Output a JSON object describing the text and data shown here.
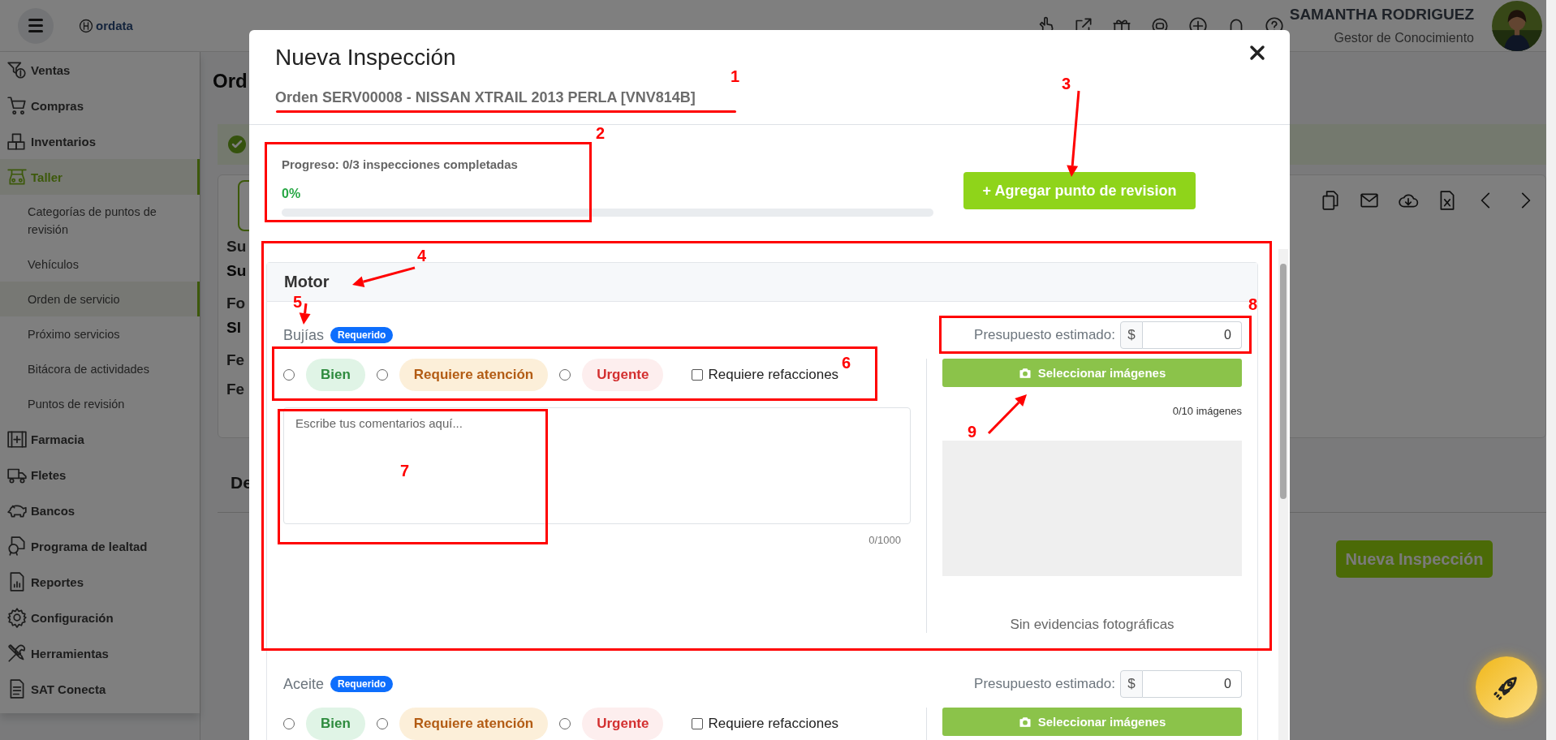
{
  "topbar": {
    "logo": "ordata",
    "user_name": "SAMANTHA RODRIGUEZ",
    "user_role": "Gestor de Conocimiento"
  },
  "sidebar": {
    "items": [
      {
        "label": "Ventas",
        "expanded": false
      },
      {
        "label": "Compras",
        "expanded": false
      },
      {
        "label": "Inventarios",
        "expanded": false
      },
      {
        "label": "Taller",
        "expanded": true,
        "children": [
          {
            "label": "Categorías de puntos de revisión",
            "selected": false
          },
          {
            "label": "Vehículos",
            "selected": false
          },
          {
            "label": "Orden de servicio",
            "selected": true
          },
          {
            "label": "Próximo servicios",
            "selected": false
          },
          {
            "label": "Bitácora de actividades",
            "selected": false
          },
          {
            "label": "Puntos de revisión",
            "selected": false
          }
        ]
      },
      {
        "label": "Farmacia",
        "expanded": false
      },
      {
        "label": "Fletes",
        "expanded": false
      },
      {
        "label": "Bancos",
        "expanded": false
      },
      {
        "label": "Programa de lealtad",
        "expanded": false
      },
      {
        "label": "Reportes",
        "expanded": false
      },
      {
        "label": "Configuración",
        "expanded": false
      },
      {
        "label": "Herramientas",
        "expanded": false
      },
      {
        "label": "SAT Conecta",
        "expanded": false
      }
    ]
  },
  "page": {
    "title": "Ord",
    "fields": [
      {
        "kind": "label",
        "text": "Su"
      },
      {
        "kind": "value",
        "text": "Su"
      },
      {
        "kind": "label",
        "text": "Fo"
      },
      {
        "kind": "value",
        "text": "Sl"
      },
      {
        "kind": "label",
        "text": "Fe"
      },
      {
        "kind": "label",
        "text": "Fe"
      }
    ],
    "tab": "De",
    "button": "Nueva Inspección"
  },
  "modal": {
    "title": "Nueva Inspección",
    "subtitle": "Orden SERV00008 - NISSAN XTRAIL 2013 PERLA [VNV814B]",
    "progress": {
      "label": "Progreso: 0/3 inspecciones completadas",
      "percent": "0%",
      "level": 0
    },
    "add_button": "+ Agregar punto de revision",
    "sections": [
      {
        "title": "Motor",
        "items": [
          {
            "name": "Bujías",
            "badge": "Requerido",
            "options": [
              {
                "label": "Bien",
                "kind": "good",
                "selected": false
              },
              {
                "label": "Requiere atención",
                "kind": "warning",
                "selected": false
              },
              {
                "label": "Urgente",
                "kind": "urgent",
                "selected": false
              }
            ],
            "parts": {
              "label": "Requiere refacciones",
              "checked": false
            },
            "comment": {
              "placeholder": "Escribe tus comentarios aquí...",
              "counter": "0/1000"
            },
            "budget": {
              "label": "Presupuesto estimado:",
              "currency": "$",
              "value": "0"
            },
            "upload": {
              "button": "Seleccionar imágenes",
              "counter": "0/10 imágenes",
              "empty": "Sin evidencias fotográficas"
            }
          },
          {
            "name": "Aceite",
            "badge": "Requerido",
            "options": [
              {
                "label": "Bien",
                "kind": "good",
                "selected": false
              },
              {
                "label": "Requiere atención",
                "kind": "warning",
                "selected": false
              },
              {
                "label": "Urgente",
                "kind": "urgent",
                "selected": false
              }
            ],
            "parts": {
              "label": "Requiere refacciones",
              "checked": false
            },
            "budget": {
              "label": "Presupuesto estimado:",
              "currency": "$",
              "value": "0"
            },
            "upload": {
              "button": "Seleccionar imágenes"
            }
          }
        ]
      }
    ]
  },
  "annotations": [
    {
      "label": "1",
      "kind": "underline"
    },
    {
      "label": "2",
      "kind": "box"
    },
    {
      "label": "3",
      "kind": "arrow"
    },
    {
      "label": "4",
      "kind": "box_arrow"
    },
    {
      "label": "5",
      "kind": "arrow"
    },
    {
      "label": "6",
      "kind": "box"
    },
    {
      "label": "7",
      "kind": "box"
    },
    {
      "label": "8",
      "kind": "box"
    },
    {
      "label": "9",
      "kind": "arrow"
    }
  ]
}
